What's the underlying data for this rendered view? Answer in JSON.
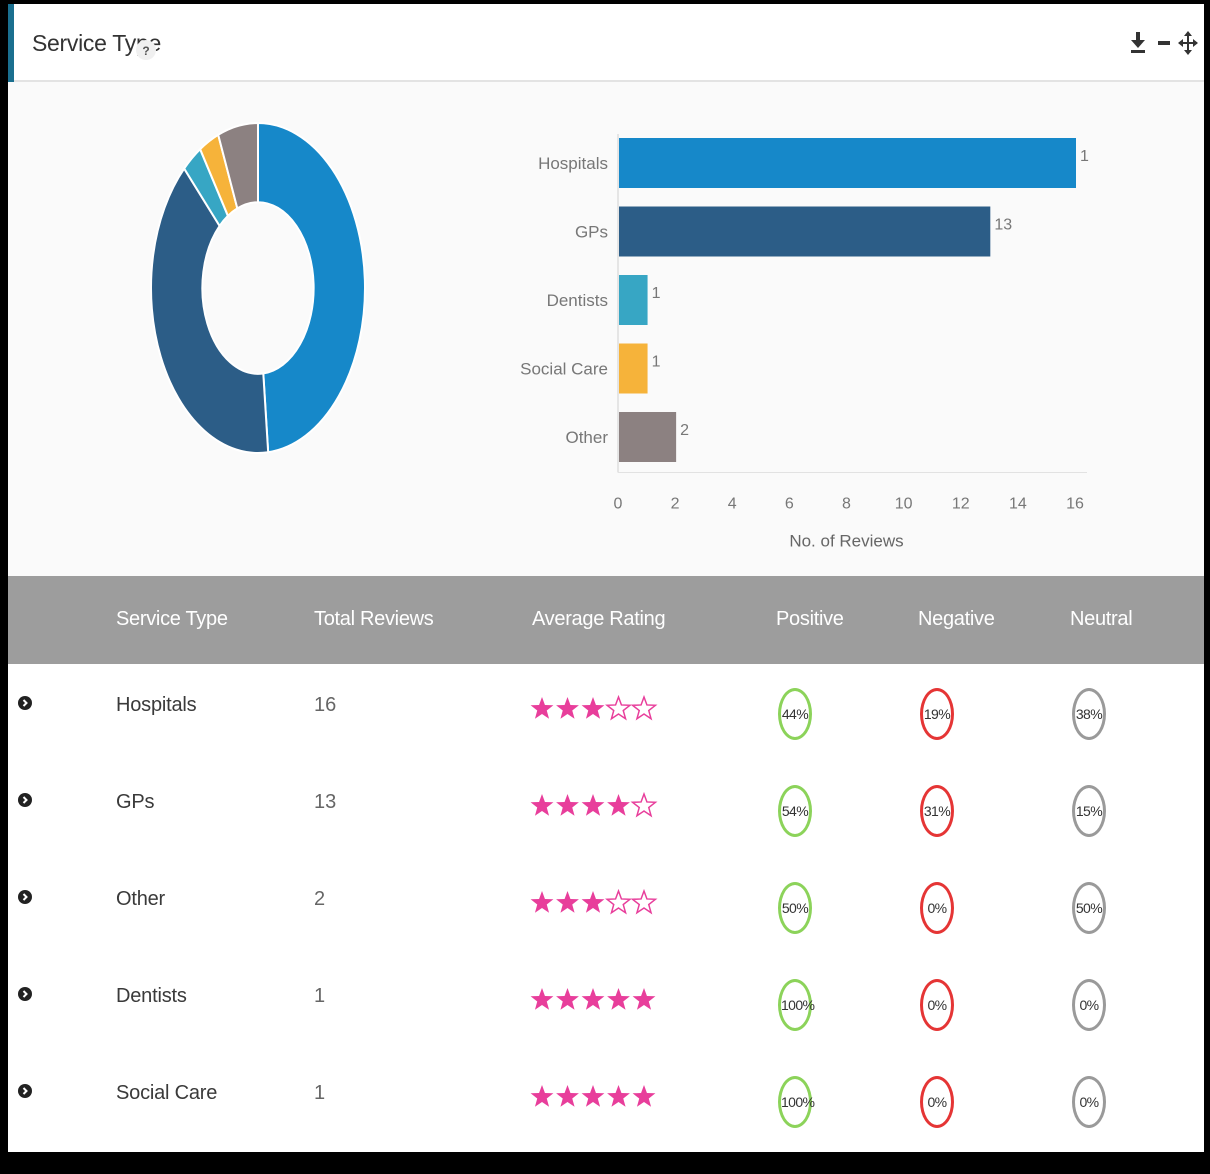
{
  "header": {
    "title": "Service Type",
    "help_icon": "?",
    "tools": [
      "download-icon",
      "minimize-icon",
      "move-icon"
    ]
  },
  "colors": {
    "hospitals": "#1688c9",
    "gps": "#2c5d87",
    "dentists": "#37a6c4",
    "social_care": "#f6b33a",
    "other": "#8c8181",
    "star": "#e83e9b",
    "positive": "#8cd35a",
    "negative": "#e53535",
    "neutral": "#9a9a9a"
  },
  "chart_data": [
    {
      "type": "pie",
      "categories": [
        "Hospitals",
        "GPs",
        "Dentists",
        "Social Care",
        "Other"
      ],
      "values": [
        16,
        13,
        1,
        1,
        2
      ]
    },
    {
      "type": "bar",
      "orientation": "horizontal",
      "categories": [
        "Hospitals",
        "GPs",
        "Dentists",
        "Social Care",
        "Other"
      ],
      "values": [
        16,
        13,
        1,
        1,
        2
      ],
      "data_labels": [
        "1",
        "13",
        "1",
        "1",
        "2"
      ],
      "xlabel": "No. of Reviews",
      "ylabel": "",
      "xlim": [
        0,
        16
      ],
      "xticks": [
        "0",
        "2",
        "4",
        "6",
        "8",
        "10",
        "12",
        "14",
        "16"
      ]
    }
  ],
  "table": {
    "columns": [
      "Service Type",
      "Total Reviews",
      "Average Rating",
      "Positive",
      "Negative",
      "Neutral"
    ],
    "rows": [
      {
        "name": "Hospitals",
        "total": "16",
        "rating": 3,
        "positive": "44%",
        "negative": "19%",
        "neutral": "38%"
      },
      {
        "name": "GPs",
        "total": "13",
        "rating": 4,
        "positive": "54%",
        "negative": "31%",
        "neutral": "15%"
      },
      {
        "name": "Other",
        "total": "2",
        "rating": 3,
        "positive": "50%",
        "negative": "0%",
        "neutral": "50%"
      },
      {
        "name": "Dentists",
        "total": "1",
        "rating": 5,
        "positive": "100%",
        "negative": "0%",
        "neutral": "0%"
      },
      {
        "name": "Social Care",
        "total": "1",
        "rating": 5,
        "positive": "100%",
        "negative": "0%",
        "neutral": "0%"
      }
    ]
  }
}
